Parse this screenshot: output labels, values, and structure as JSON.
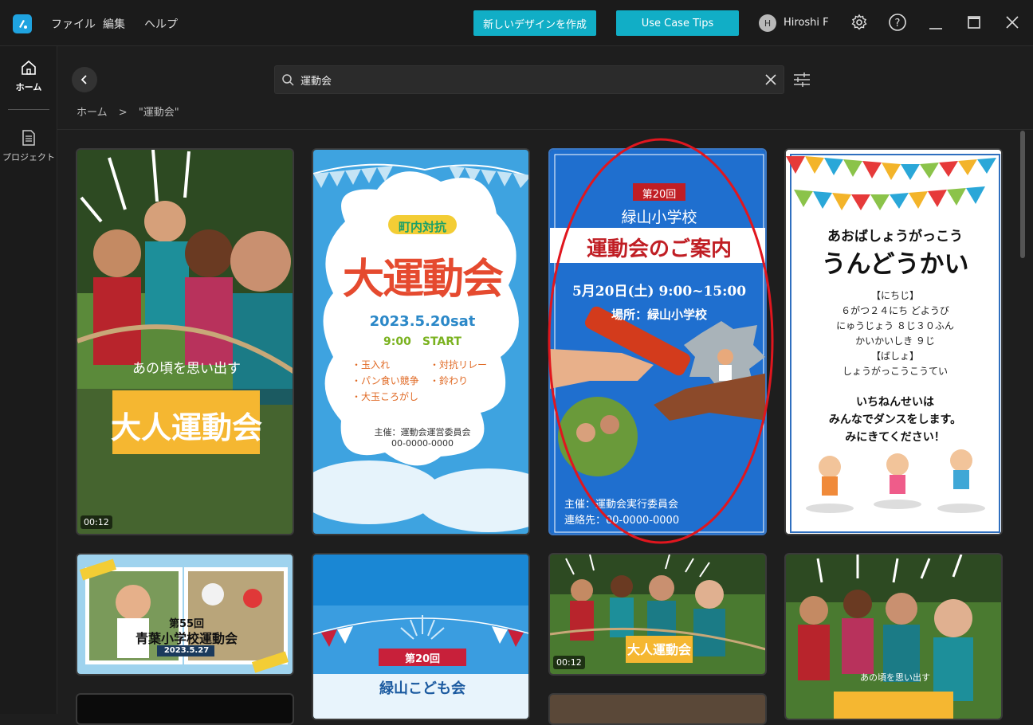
{
  "titlebar": {
    "menus": [
      "ファイル",
      "編集",
      "ヘルプ"
    ],
    "create_button": "新しいデザインを作成",
    "tips_button": "Use Case Tips",
    "avatar_letter": "H",
    "username": "Hiroshi F"
  },
  "sidebar": {
    "home_label": "ホーム",
    "project_label": "プロジェクト"
  },
  "search": {
    "value": "運動会"
  },
  "breadcrumb": {
    "home": "ホーム",
    "separator": ">",
    "current": "\"運動会\""
  },
  "cards": {
    "c1": {
      "subtitle": "あの頃を思い出す",
      "title": "大人運動会",
      "duration": "00:12"
    },
    "c2": {
      "badge": "町内対抗",
      "title": "大運動会",
      "date": "2023.5.20sat",
      "time": "9:00　START",
      "events": [
        "・玉入れ",
        "・パン食い競争",
        "・大玉ころがし",
        "・対抗リレー",
        "・鈴わり"
      ],
      "host": "主催：運動会運営委員会",
      "phone": "00-0000-0000"
    },
    "c3": {
      "badge": "第20回",
      "school": "緑山小学校",
      "title": "運動会のご案内",
      "datetime": "5月20日(土) 9:00~15:00",
      "place": "場所：緑山小学校",
      "host": "主催：運動会実行委員会",
      "contact": "連絡先：00-0000-0000"
    },
    "c4": {
      "school": "あおばしょうがっこう",
      "title": "うんどうかい",
      "lines": [
        "【にちじ】",
        "６がつ２４にち どようび",
        "にゅうじょう ８じ３０ふん",
        "かいかいしき ９じ",
        "【ばしょ】",
        "しょうがっこうこうてい"
      ],
      "message1": "いちねんせいは",
      "message2": "みんなでダンスをします。",
      "message3": "みにきてください！"
    },
    "c5": {
      "line1": "第55回",
      "line2": "青葉小学校運動会",
      "date": "2023.5.27"
    },
    "c6": {
      "badge": "第20回",
      "title": "緑山こども会"
    },
    "c7": {
      "title": "大人運動会",
      "duration": "00:12"
    },
    "c8": {
      "subtitle": "あの頃を思い出す"
    }
  },
  "colors": {
    "accent_teal": "#11aec6",
    "annotation_red": "#e0161e"
  }
}
